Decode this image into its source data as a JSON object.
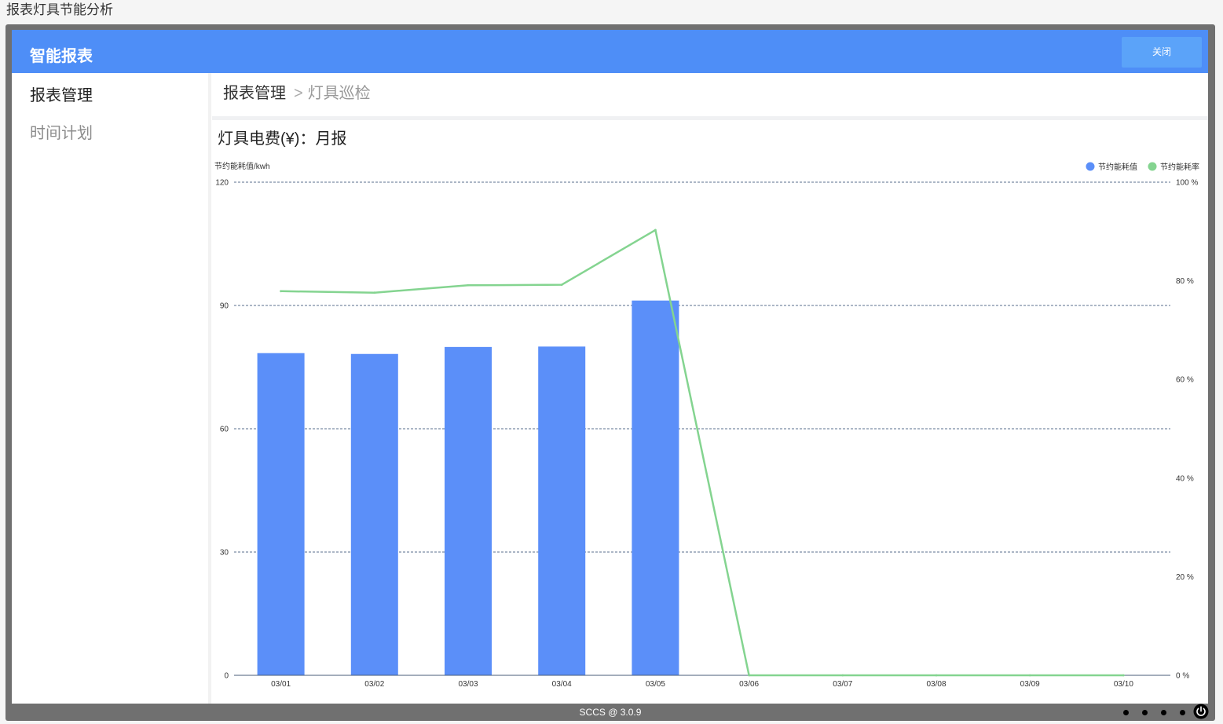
{
  "page": {
    "title": "报表灯具节能分析"
  },
  "theme": {
    "page_bg": "#f5f5f5",
    "frame": "#707070",
    "header": "#4e8ef7",
    "close_button": "#5ba3f9"
  },
  "header": {
    "title": "智能报表",
    "close_label": "关闭"
  },
  "sidebar": {
    "items": [
      {
        "label": "报表管理",
        "active": true
      },
      {
        "label": "时间计划",
        "active": false
      }
    ]
  },
  "breadcrumb": {
    "root": "报表管理",
    "separator": ">",
    "current": "灯具巡检"
  },
  "chart_data": {
    "type": "bar",
    "title": "灯具电费(¥)：月报",
    "ylabel": "节约能耗值/kwh",
    "categories": [
      "03/01",
      "03/02",
      "03/03",
      "03/04",
      "03/05",
      "03/06",
      "03/07",
      "03/08",
      "03/09",
      "03/10"
    ],
    "ylim": [
      0,
      120
    ],
    "yticks": [
      0,
      30,
      60,
      90,
      120
    ],
    "y2lim": [
      0,
      100
    ],
    "y2ticks": [
      0,
      20,
      40,
      60,
      80,
      100
    ],
    "y2tick_suffix": " %",
    "grid": true,
    "legend": "top-right",
    "series": [
      {
        "name": "节约能耗值",
        "type": "bar",
        "axis": "left",
        "color": "#5b8ff9",
        "values": [
          78.4,
          78.2,
          79.9,
          80.0,
          91.2,
          0,
          0,
          0,
          0,
          0
        ]
      },
      {
        "name": "节约能耗率",
        "type": "line",
        "axis": "right",
        "color": "#84d490",
        "values": [
          77.9,
          77.6,
          79.1,
          79.2,
          90.3,
          0,
          0,
          0,
          0,
          0
        ]
      }
    ]
  },
  "footer": {
    "text": "SCCS @ 3.0.9",
    "icons": [
      "status-dot-icon",
      "status-dot-icon",
      "status-dot-icon",
      "status-dot-icon",
      "power-icon"
    ]
  }
}
